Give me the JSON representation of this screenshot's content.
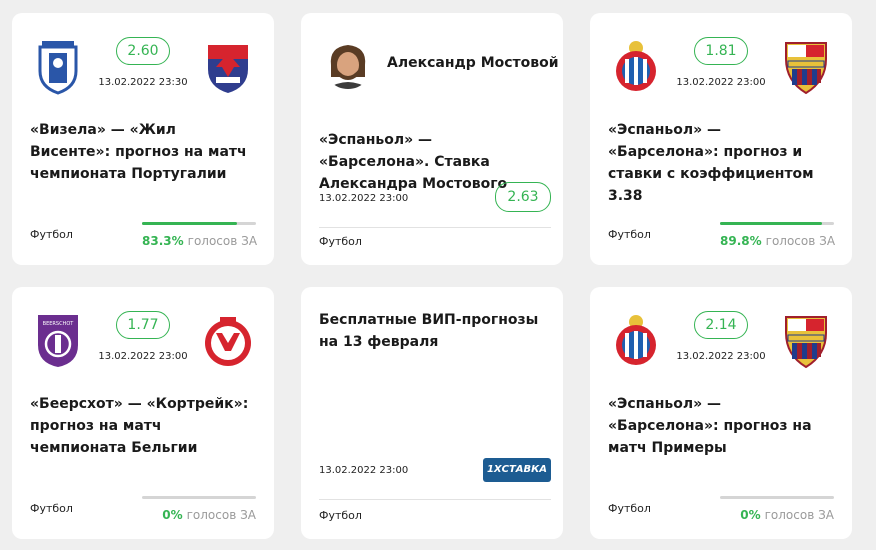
{
  "cards": [
    {
      "odds": "2.60",
      "date": "13.02.2022 23:30",
      "title": "«Визела» — «Жил Висенте»: прогноз на матч чемпионата Португалии",
      "sport": "Футбол",
      "vote_pct": "83.3%",
      "vote_fraction": 0.833,
      "vote_label": "голосов ЗА",
      "home_logo": "vizela-logo-icon",
      "away_logo": "gil-vicente-logo-icon"
    },
    {
      "author": "Александр Мостовой",
      "author_photo": "author-avatar-icon",
      "title": "«Эспаньол» — «Барселона». Ставка Александра Мостового",
      "date": "13.02.2022 23:00",
      "odds": "2.63",
      "sport": "Футбол"
    },
    {
      "odds": "1.81",
      "date": "13.02.2022 23:00",
      "title": "«Эспаньол» — «Барселона»: прогноз и ставки с коэффициентом 3.38",
      "sport": "Футбол",
      "vote_pct": "89.8%",
      "vote_fraction": 0.898,
      "vote_label": "голосов ЗА",
      "home_logo": "espanyol-logo-icon",
      "away_logo": "barcelona-logo-icon"
    },
    {
      "odds": "1.77",
      "date": "13.02.2022 23:00",
      "title": "«Беерсхот» — «Кортрейк»: прогноз на матч чемпионата Бельгии",
      "sport": "Футбол",
      "vote_pct": "0%",
      "vote_fraction": 0,
      "vote_label": "голосов ЗА",
      "home_logo": "beerschot-logo-icon",
      "home_logo_text": "BEERSCHOT",
      "away_logo": "kortrijk-logo-icon"
    },
    {
      "title": "Бесплатные ВИП-прогнозы на 13 февраля",
      "date": "13.02.2022 23:00",
      "bookmaker": "1XСТАВКА",
      "sport": "Футбол"
    },
    {
      "odds": "2.14",
      "date": "13.02.2022 23:00",
      "title": "«Эспаньол» — «Барселона»: прогноз на матч Примеры",
      "sport": "Футбол",
      "vote_pct": "0%",
      "vote_fraction": 0,
      "vote_label": "голосов ЗА",
      "home_logo": "espanyol-logo-icon",
      "away_logo": "barcelona-logo-icon"
    }
  ],
  "colors": {
    "accent": "#35b453",
    "card_bg": "#ffffff",
    "page_bg": "#efefef",
    "bookmaker_bg": "#1d5c92"
  }
}
